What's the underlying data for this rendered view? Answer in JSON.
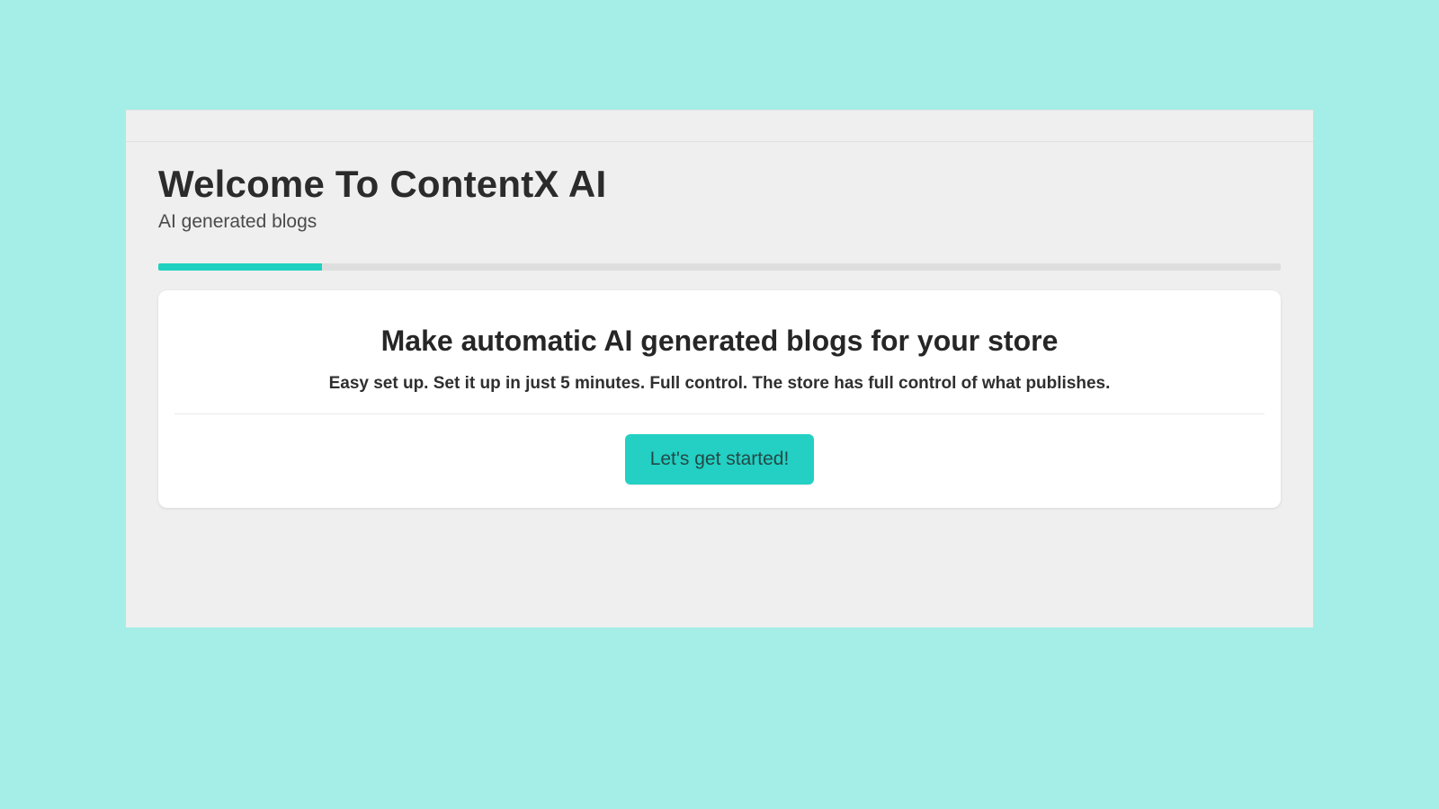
{
  "colors": {
    "page_bg": "#a4eee7",
    "panel_bg": "#efefef",
    "accent": "#23d0c3",
    "progress_track": "#dedede"
  },
  "header": {
    "title": "Welcome To ContentX AI",
    "subtitle": "AI generated blogs"
  },
  "progress": {
    "percent": 14.6
  },
  "card": {
    "headline": "Make automatic AI generated blogs for your store",
    "subheadline": "Easy set up. Set it up in just 5 minutes. Full control. The store has full control of what publishes.",
    "cta_label": "Let's get started!"
  }
}
